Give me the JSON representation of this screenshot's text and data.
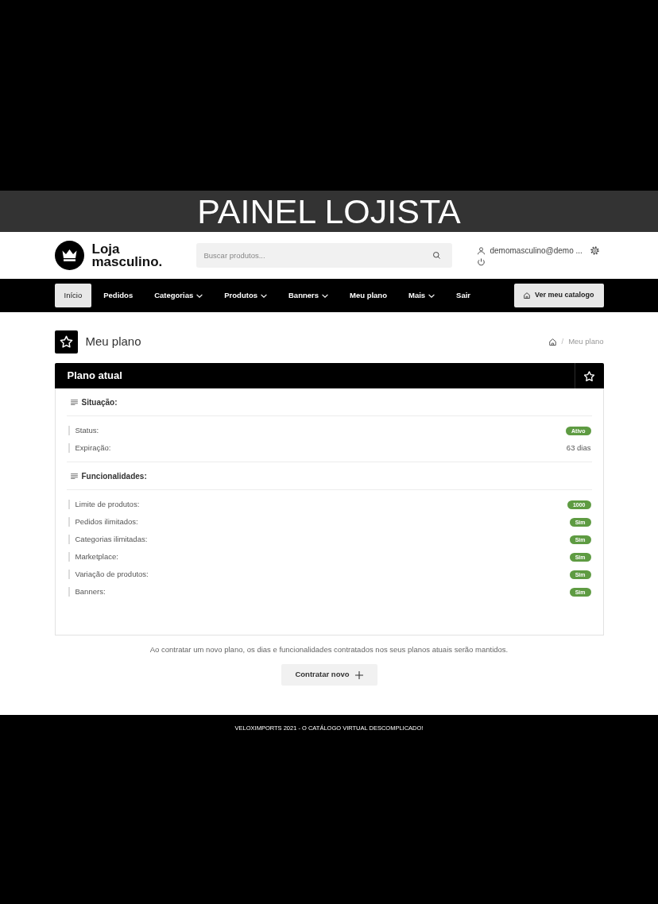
{
  "caption": "PAINEL LOJISTA",
  "header": {
    "logo_lines": [
      "Loja",
      "masculino."
    ],
    "search": {
      "placeholder": "Buscar produtos..."
    },
    "user": {
      "email": "demomasculino@demo ..."
    }
  },
  "nav": {
    "items": [
      {
        "label": "Início",
        "selected": true,
        "dropdown": false
      },
      {
        "label": "Pedidos",
        "selected": false,
        "dropdown": false
      },
      {
        "label": "Categorias",
        "selected": false,
        "dropdown": true
      },
      {
        "label": "Produtos",
        "selected": false,
        "dropdown": true
      },
      {
        "label": "Banners",
        "selected": false,
        "dropdown": true
      },
      {
        "label": "Meu plano",
        "selected": false,
        "dropdown": false
      },
      {
        "label": "Mais",
        "selected": false,
        "dropdown": true
      },
      {
        "label": "Sair",
        "selected": false,
        "dropdown": false
      }
    ],
    "catalog_button": "Ver meu catalogo"
  },
  "page": {
    "title": "Meu plano",
    "breadcrumb": {
      "separator": "/",
      "current": "Meu plano"
    }
  },
  "card": {
    "title": "Plano atual",
    "sections": [
      {
        "heading": "Situação:",
        "rows": [
          {
            "label": "Status:",
            "value": "Ativo",
            "kind": "badge"
          },
          {
            "label": "Expiração:",
            "value": "63 dias",
            "kind": "text"
          }
        ]
      },
      {
        "heading": "Funcionalidades:",
        "rows": [
          {
            "label": "Limite de produtos:",
            "value": "1000",
            "kind": "badge"
          },
          {
            "label": "Pedidos ilimitados:",
            "value": "Sim",
            "kind": "badge"
          },
          {
            "label": "Categorias ilimitadas:",
            "value": "Sim",
            "kind": "badge"
          },
          {
            "label": "Marketplace:",
            "value": "Sim",
            "kind": "badge"
          },
          {
            "label": "Variação de produtos:",
            "value": "Sim",
            "kind": "badge"
          },
          {
            "label": "Banners:",
            "value": "Sim",
            "kind": "badge"
          }
        ]
      }
    ]
  },
  "note": "Ao contratar um novo plano, os dias e funcionalidades contratados nos seus planos atuais serão mantidos.",
  "contract_button": "Contratar novo",
  "footer": "VELOXIMPORTS 2021 - O CATÁLOGO VIRTUAL DESCOMPLICADO!"
}
